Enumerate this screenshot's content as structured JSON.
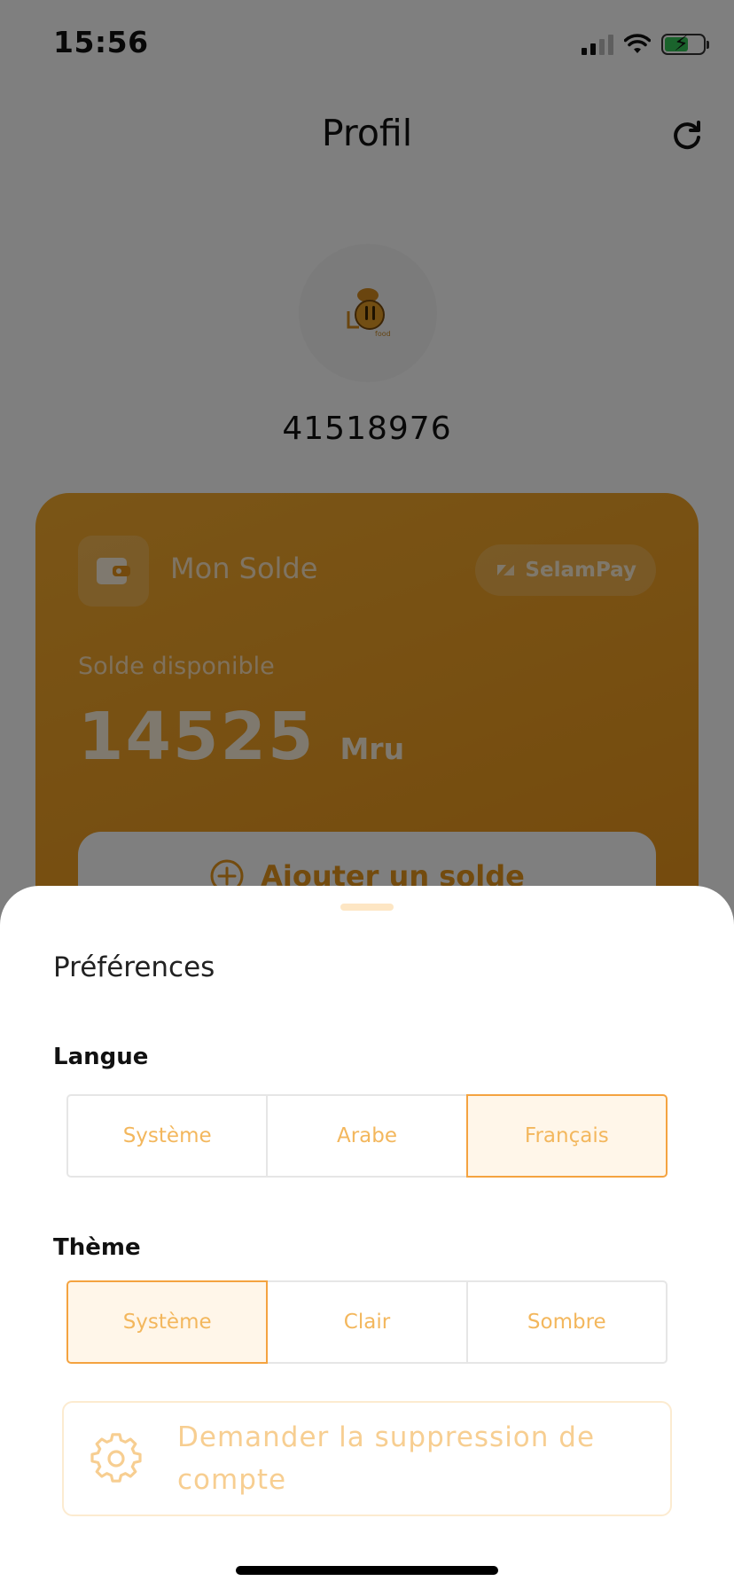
{
  "status": {
    "time": "15:56"
  },
  "header": {
    "title": "Profil",
    "refresh_icon": "refresh-icon"
  },
  "profile": {
    "phone": "41518976",
    "avatar_icon": "chef-logo-icon"
  },
  "balance_card": {
    "title": "Mon Solde",
    "brand": "SelamPay",
    "subtitle": "Solde disponible",
    "amount": "14525",
    "currency": "Mru",
    "add_button_label": "Ajouter un solde",
    "accent_color": "#f2a224"
  },
  "sheet": {
    "title": "Préférences",
    "language": {
      "label": "Langue",
      "options": [
        "Système",
        "Arabe",
        "Français"
      ],
      "selected": "Français"
    },
    "theme": {
      "label": "Thème",
      "options": [
        "Système",
        "Clair",
        "Sombre"
      ],
      "selected": "Système"
    },
    "delete_account_label": "Demander la suppression de compte"
  },
  "colors": {
    "accent": "#f4a340",
    "accent_light": "#fff6e9",
    "scrim": "rgba(0,0,0,0.5)"
  }
}
